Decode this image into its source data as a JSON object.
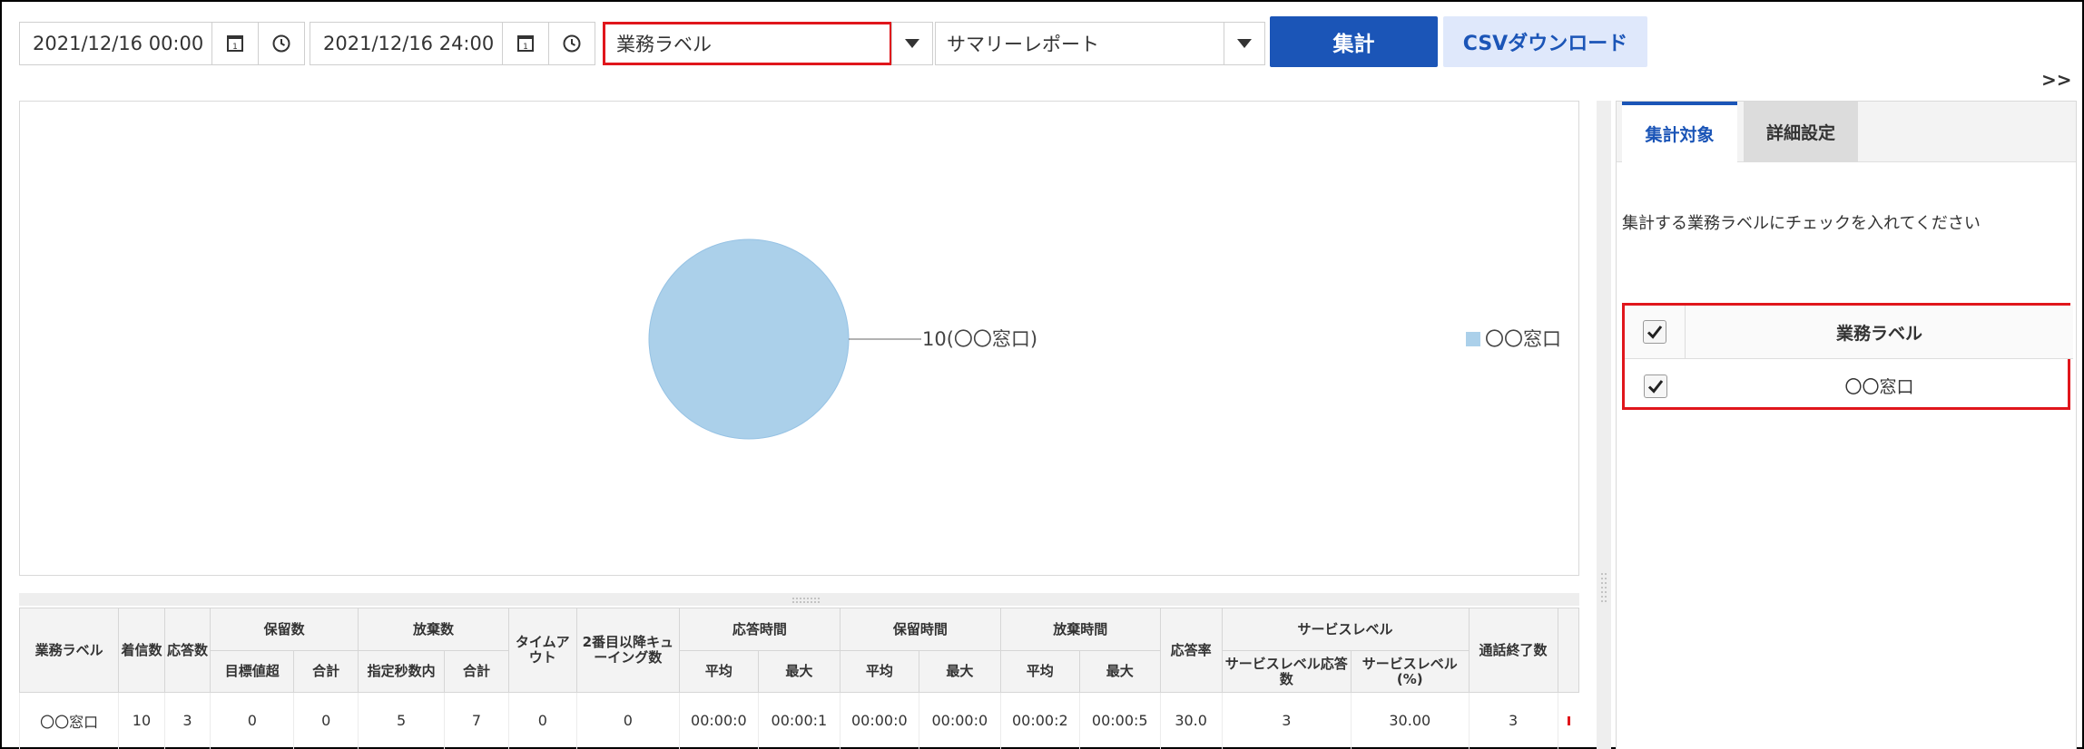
{
  "toolbar": {
    "start_datetime": "2021/12/16 00:00",
    "end_datetime": "2021/12/16 24:00",
    "label_select": "業務ラベル",
    "report_select": "サマリーレポート",
    "aggregate_button": "集計",
    "csv_button": "CSVダウンロード",
    "collapse": ">>"
  },
  "colors": {
    "accent": "#1b55b7",
    "pie": "#abd0ea",
    "highlight": "#e0161c"
  },
  "chart_data": {
    "type": "pie",
    "slices": [
      {
        "name": "〇〇窓口",
        "value": 10,
        "color": "#abd0ea"
      }
    ],
    "data_labels": [
      "10(〇〇窓口)"
    ],
    "legend": [
      "〇〇窓口"
    ],
    "legend_position": "right"
  },
  "table": {
    "group_headers": {
      "label": "業務ラベル",
      "incoming": "着信数",
      "answered": "応答数",
      "hold_count": "保留数",
      "abandon_count": "放棄数",
      "timeout": "タイムアウト",
      "second_queue": "2番目以降キューイング数",
      "answer_time": "応答時間",
      "hold_time": "保留時間",
      "abandon_time": "放棄時間",
      "answer_rate": "応答率",
      "service_level": "サービスレベル",
      "call_end": "通話終了数"
    },
    "sub_headers": {
      "target_exceeded": "目標値超",
      "total": "合計",
      "within_seconds": "指定秒数内",
      "average": "平均",
      "maximum": "最大",
      "sl_answered": "サービスレベル応答数",
      "sl_percent": "サービスレベル(%)"
    },
    "rows": [
      {
        "label": "〇〇窓口",
        "incoming": "10",
        "answered": "3",
        "hold_target": "0",
        "hold_total": "0",
        "abandon_within": "5",
        "abandon_total": "7",
        "timeout": "0",
        "second_queue": "0",
        "answer_avg": "00:00:0",
        "answer_max": "00:00:1",
        "hold_avg": "00:00:0",
        "hold_max": "00:00:0",
        "abandon_avg": "00:00:2",
        "abandon_max": "00:00:5",
        "answer_rate": "30.0",
        "sl_answered": "3",
        "sl_percent": "30.00",
        "call_end": "3"
      }
    ]
  },
  "side_panel": {
    "tabs": [
      "集計対象",
      "詳細設定"
    ],
    "message": "集計する業務ラベルにチェックを入れてください",
    "label_header": "業務ラベル",
    "labels": [
      "〇〇窓口"
    ]
  }
}
